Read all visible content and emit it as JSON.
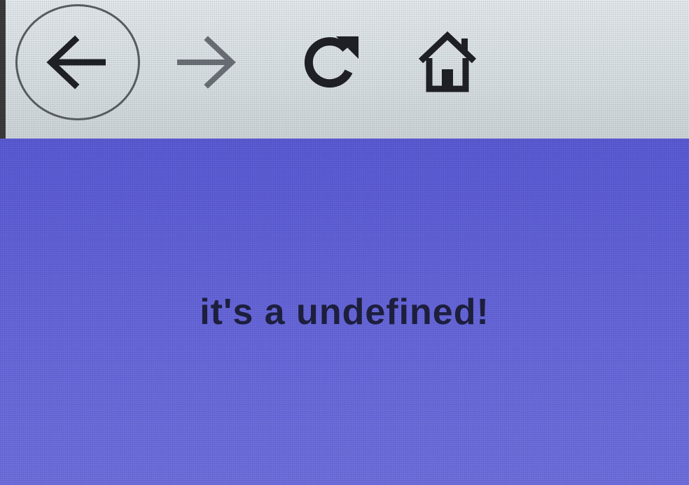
{
  "toolbar": {
    "buttons": [
      {
        "name": "back",
        "icon": "arrow-left-icon"
      },
      {
        "name": "forward",
        "icon": "arrow-right-icon"
      },
      {
        "name": "reload",
        "icon": "reload-icon"
      },
      {
        "name": "home",
        "icon": "home-icon"
      }
    ]
  },
  "content": {
    "message": "it's a undefined!"
  },
  "colors": {
    "toolbar_bg": "#dde3e7",
    "content_bg": "#6262da",
    "icon_dark": "#1f2126",
    "icon_light": "#6b7077",
    "text": "#1e2040"
  }
}
